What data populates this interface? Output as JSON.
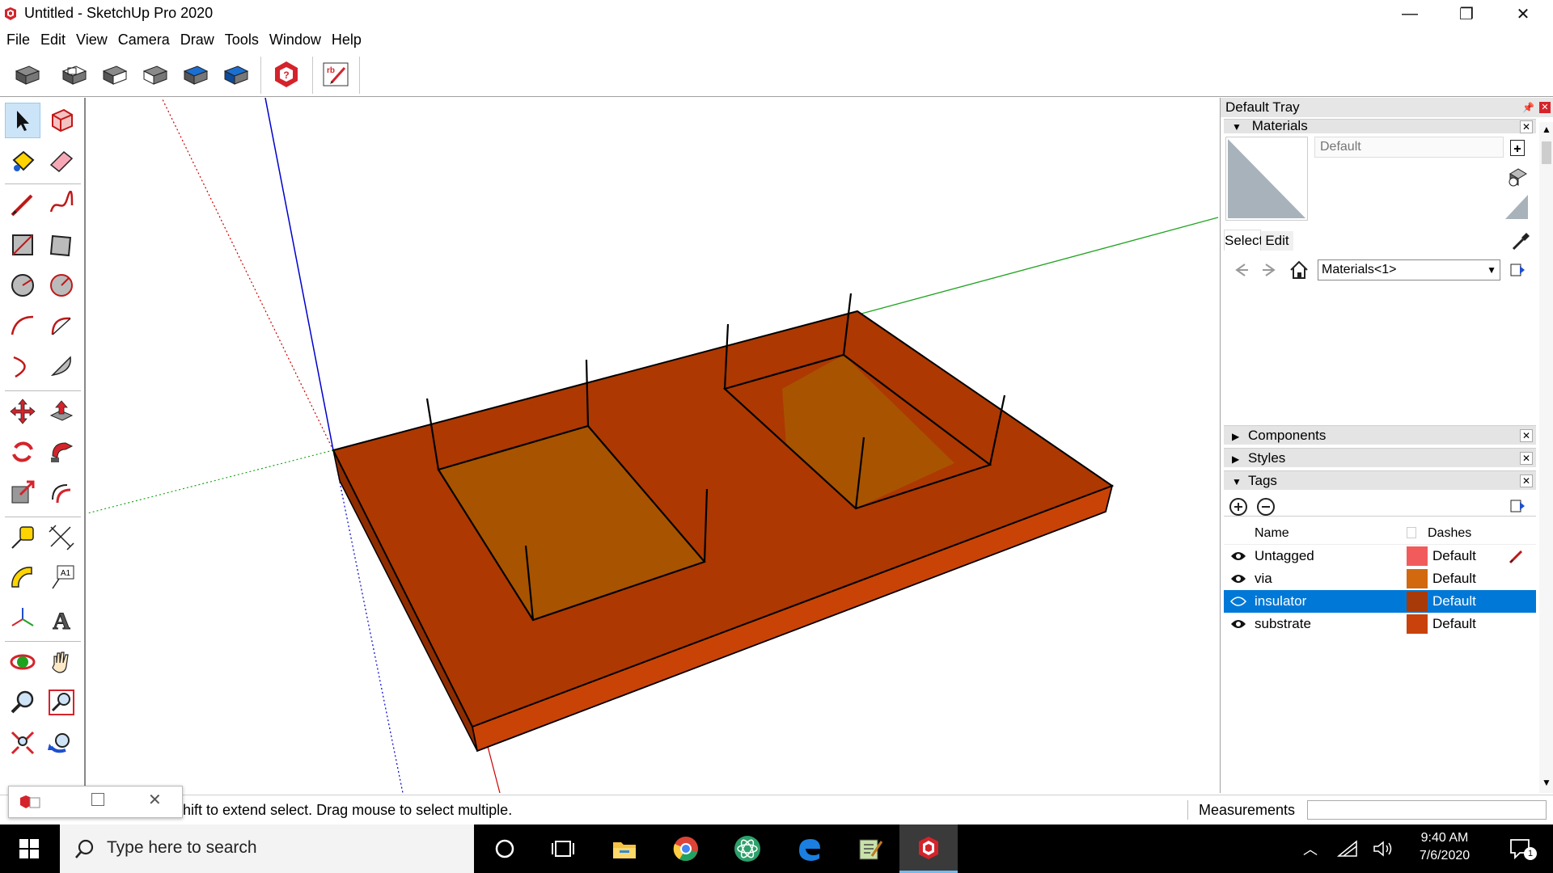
{
  "window": {
    "title": "Untitled - SketchUp Pro 2020",
    "minimize_glyph": "—",
    "restore_glyph": "❐",
    "close_glyph": "✕"
  },
  "menu": [
    "File",
    "Edit",
    "View",
    "Camera",
    "Draw",
    "Tools",
    "Window",
    "Help"
  ],
  "toolbar": {
    "icons": [
      "views-iso-icon",
      "views-top-icon",
      "views-front-icon",
      "views-right-icon",
      "views-back-icon",
      "views-left-icon",
      "warehouse-icon",
      "ruby-console-icon"
    ]
  },
  "palette": {
    "tools": [
      "select-tool",
      "make-component-tool",
      "paint-bucket-tool",
      "eraser-tool",
      "line-tool",
      "freehand-tool",
      "rectangle-tool",
      "rotated-rectangle-tool",
      "circle-tool",
      "polygon-tool",
      "arc-tool",
      "two-point-arc-tool",
      "three-point-arc-tool",
      "pie-tool",
      "move-tool",
      "push-pull-tool",
      "rotate-tool",
      "follow-me-tool",
      "scale-tool",
      "offset-tool",
      "tape-measure-tool",
      "dimension-tool",
      "protractor-tool",
      "text-tool",
      "axes-tool",
      "3d-text-tool",
      "orbit-tool",
      "pan-tool",
      "zoom-tool",
      "zoom-window-tool",
      "zoom-extents-tool",
      "previous-view-tool"
    ],
    "text_tool_label": "A1",
    "text3d_label": "A"
  },
  "tray": {
    "title": "Default Tray",
    "materials": {
      "header": "Materials",
      "name_placeholder": "Default",
      "tabs": [
        "Select",
        "Edit"
      ],
      "collection": "Materials<1>"
    },
    "panels": [
      "Components",
      "Styles",
      "Tags"
    ],
    "tags": {
      "col_name": "Name",
      "col_dashes": "Dashes",
      "rows": [
        {
          "name": "Untagged",
          "dashes": "Default",
          "color": "#f15b5b",
          "visible": true,
          "selected": false
        },
        {
          "name": "via",
          "dashes": "Default",
          "color": "#d2690e",
          "visible": true,
          "selected": false
        },
        {
          "name": "insulator",
          "dashes": "Default",
          "color": "#a83a0a",
          "visible": false,
          "selected": true
        },
        {
          "name": "substrate",
          "dashes": "Default",
          "color": "#c9420b",
          "visible": true,
          "selected": false
        }
      ]
    }
  },
  "status": {
    "hint": "hift to extend select. Drag mouse to select multiple.",
    "measurements_label": "Measurements",
    "measurements_value": ""
  },
  "taskbar": {
    "search_placeholder": "Type here to search",
    "apps": [
      "cortana-icon",
      "task-view-icon",
      "file-explorer-icon",
      "chrome-icon",
      "atom-icon",
      "edge-icon",
      "notepad-icon",
      "sketchup-icon"
    ],
    "time": "9:40 AM",
    "date": "7/6/2020",
    "notification_count": "1"
  },
  "colors": {
    "substrate_top": "#ad3802",
    "substrate_side": "#c94306",
    "well_floor": "#a85300",
    "selection_blue": "#0078d7",
    "axis_red": "#cc0000",
    "axis_green": "#1fa31f",
    "axis_blue": "#0000cc"
  }
}
